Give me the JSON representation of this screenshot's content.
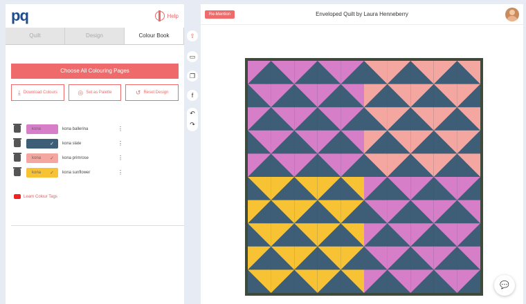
{
  "app": {
    "logo": "pq",
    "help_label": "Help"
  },
  "left": {
    "tabs": [
      {
        "label": "Quilt",
        "active": false
      },
      {
        "label": "Design",
        "active": false
      },
      {
        "label": "Colour Book",
        "active": true
      }
    ],
    "primary_button": "Choose All Colouring Pages",
    "buttons": [
      {
        "icon": "download-icon",
        "label": "Download Colours"
      },
      {
        "icon": "target-icon",
        "label": "Set as Palette"
      },
      {
        "icon": "reset-icon",
        "label": "Reset Design"
      }
    ],
    "swatches": [
      {
        "name": "kona ballerina",
        "chip": "kona",
        "color": "#d67ec8"
      },
      {
        "name": "kona slate",
        "chip": "",
        "color": "#3e5e78"
      },
      {
        "name": "kona primrose",
        "chip": "kona",
        "color": "#f4a6a0"
      },
      {
        "name": "kona sunflower",
        "chip": "kona",
        "color": "#f7c233"
      }
    ],
    "learn_link": "Learn Colour Tags"
  },
  "toolbar": [
    "pin-icon",
    "monitor-icon",
    "copy-icon",
    "facebook-icon",
    "undo-icon"
  ],
  "main": {
    "redesign_label": "Re-Mention",
    "title": "Enveloped Quilt  by Laura Henneberry"
  },
  "colors": {
    "accent": "#ef6b6b",
    "slate": "#3e5e78",
    "pink": "#d67ec8",
    "salmon": "#f4a6a0",
    "yellow": "#f7c233"
  }
}
